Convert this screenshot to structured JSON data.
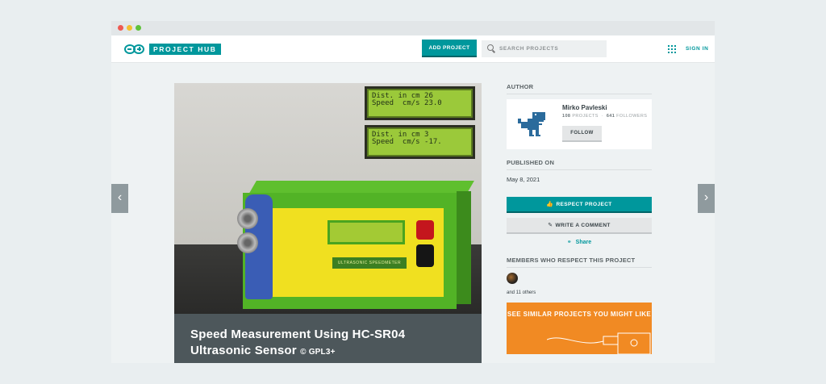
{
  "header": {
    "logo_text": "PROJECT HUB",
    "add_project_label": "ADD PROJECT",
    "search_placeholder": "SEARCH PROJECTS",
    "sign_in_label": "SIGN IN"
  },
  "hero": {
    "title": "Speed Measurement Using HC-SR04 Ultrasonic Sensor",
    "license": "© GPL3+",
    "lcd_top": [
      "Dist. in cm 26",
      "Speed  cm/s 23.0"
    ],
    "lcd_bottom": [
      "Dist. in cm 3",
      "Speed  cm/s -17."
    ],
    "sticker_text": "ULTRASONIC SPEEDMETER"
  },
  "sidebar": {
    "author_heading": "AUTHOR",
    "author_name": "Mirko Pavleski",
    "projects_count": "108",
    "projects_label": "PROJECTS",
    "followers_count": "641",
    "followers_label": "FOLLOWERS",
    "follow_label": "FOLLOW",
    "published_heading": "PUBLISHED ON",
    "published_date": "May 8, 2021",
    "respect_label": "RESPECT PROJECT",
    "comment_label": "WRITE A COMMENT",
    "share_label": "Share",
    "members_heading": "MEMBERS WHO RESPECT THIS PROJECT",
    "others_text": "and 11 others",
    "similar_text": "SEE SIMILAR PROJECTS YOU MIGHT LIKE"
  },
  "colors": {
    "accent": "#00979c",
    "orange": "#f18a23",
    "caption_bg": "#4d575b"
  }
}
